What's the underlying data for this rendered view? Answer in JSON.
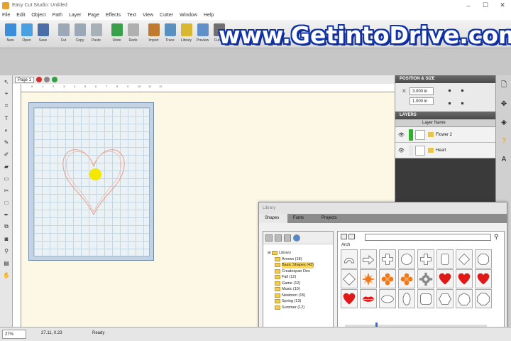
{
  "window": {
    "title": "Easy Cut Studio: Untitled",
    "controls": [
      "–",
      "☐",
      "✕"
    ]
  },
  "menu": [
    "File",
    "Edit",
    "Object",
    "Path",
    "Layer",
    "Page",
    "Effects",
    "Text",
    "View",
    "Cutter",
    "Window",
    "Help"
  ],
  "toolbar": [
    {
      "label": "New",
      "color": "#3d8ed8"
    },
    {
      "label": "Open",
      "color": "#4aa0e0"
    },
    {
      "label": "Save",
      "color": "#4b6ea8"
    },
    {
      "label": "Cut",
      "color": "#9aa8b8"
    },
    {
      "label": "Copy",
      "color": "#9aa8b8"
    },
    {
      "label": "Paste",
      "color": "#a8b0b8"
    },
    {
      "label": "Undo",
      "color": "#3aa04a"
    },
    {
      "label": "Redo",
      "color": "#b0b0b0"
    },
    {
      "label": "Import",
      "color": "#c07a30"
    },
    {
      "label": "Trace",
      "color": "#5a90c0"
    },
    {
      "label": "Library",
      "color": "#d8b830"
    },
    {
      "label": "Preview",
      "color": "#6090c8"
    },
    {
      "label": "Cutter",
      "color": "#707070"
    }
  ],
  "watermark": "www.GetintoDrive.com",
  "left_tools": [
    "pointer-tool",
    "node-tool",
    "crop-tool",
    "text-tool",
    "fill-tool",
    "pen-tool",
    "brush-tool",
    "eraser-tool",
    "rectangle-tool",
    "knife-tool",
    "square-tool",
    "weld-tool",
    "transform-tool",
    "shadow-tool",
    "zoom-tool",
    "measure-tool",
    "hand-tool"
  ],
  "left_tool_glyphs": [
    "↖",
    "⌖",
    "⌗",
    "T",
    "◐",
    "✎",
    "✐",
    "▰",
    "▭",
    "✂",
    "□",
    "✒",
    "⧉",
    "◙",
    "⚲",
    "▤",
    "✋"
  ],
  "doc": {
    "tab": "Page 1"
  },
  "ruler": {
    "ticks": [
      "0",
      "1",
      "2",
      "3",
      "4",
      "5",
      "6",
      "7",
      "8",
      "9",
      "10",
      "11",
      "12"
    ]
  },
  "position_size": {
    "header": "POSITION & SIZE",
    "x_label": "X:",
    "x_value": "3.000 in",
    "y_value": "1.000 in"
  },
  "layers": {
    "header": "LAYERS",
    "column": "Layer Name",
    "rows": [
      {
        "name": "Flower 2",
        "swatch": "#2fb02f"
      },
      {
        "name": "Heart",
        "swatch": "#e8e8e8"
      }
    ]
  },
  "library": {
    "title": "Library",
    "tabs": [
      "Shapes",
      "Fonts",
      "Projects"
    ],
    "tree_root": "Library",
    "tree_items": [
      "Arrows (18)",
      "Basic Shapes (43)",
      "Createspan Des",
      "Fall (12)",
      "Game (12)",
      "Music (10)",
      "Newborn (15)",
      "Spring (13)",
      "Summer (12)"
    ],
    "category": "Arch",
    "shapes": [
      "arch",
      "arrow",
      "cross-round",
      "circle",
      "cross",
      "rounded-rect",
      "diamond-round",
      "octagon-round",
      "diamond",
      "sun-flower",
      "flower",
      "flower",
      "gear",
      "heart",
      "heart",
      "heart",
      "heart",
      "lips",
      "ellipse",
      "oval",
      "rounded-square",
      "hexagon",
      "heptagon",
      "octagon"
    ]
  },
  "status": {
    "zoom": "27%",
    "coords": "27.11, 0.23",
    "state": "Ready"
  },
  "colors": {
    "mat_grid": "#eaf2f6",
    "canvas": "#fdf8e6",
    "dot": "#f5e800",
    "heart_outline": "#e8a08c",
    "shape_red": "#e01818",
    "shape_orange": "#f07818"
  }
}
